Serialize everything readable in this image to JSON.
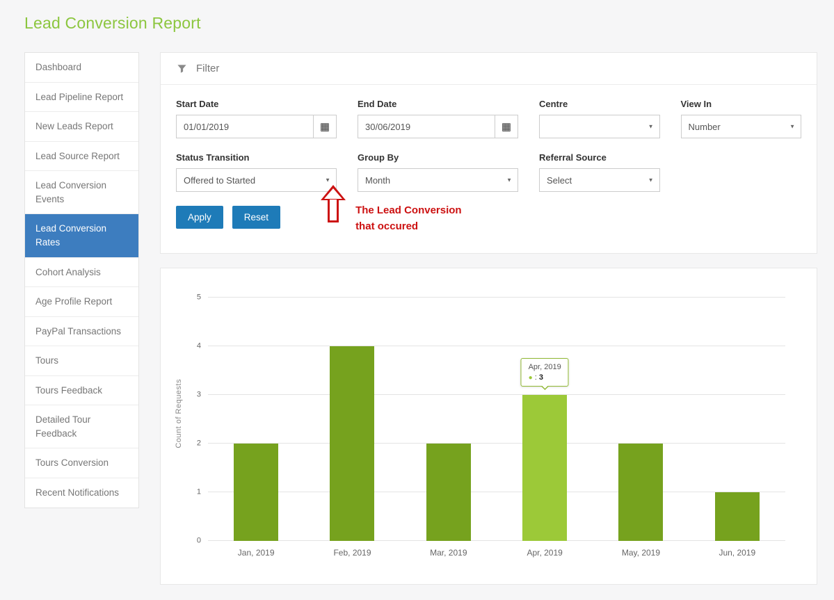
{
  "page": {
    "title": "Lead Conversion Report"
  },
  "colors": {
    "title_green": "#8cc63f",
    "sidebar_active_bg": "#3d7dbf",
    "button_blue": "#1e7bb8",
    "annotation_red": "#cc1212",
    "bar_green": "#76a21e",
    "bar_highlight_green": "#9cc938",
    "tooltip_border_green": "#8fb832"
  },
  "icons": {
    "filter": "funnel-icon",
    "calendar": "▦",
    "select_caret": "▼"
  },
  "sidebar": {
    "items": [
      {
        "label": "Dashboard",
        "active": false
      },
      {
        "label": "Lead Pipeline Report",
        "active": false
      },
      {
        "label": "New Leads Report",
        "active": false
      },
      {
        "label": "Lead Source Report",
        "active": false
      },
      {
        "label": "Lead Conversion Events",
        "active": false
      },
      {
        "label": "Lead Conversion Rates",
        "active": true
      },
      {
        "label": "Cohort Analysis",
        "active": false
      },
      {
        "label": "Age Profile Report",
        "active": false
      },
      {
        "label": "PayPal Transactions",
        "active": false
      },
      {
        "label": "Tours",
        "active": false
      },
      {
        "label": "Tours Feedback",
        "active": false
      },
      {
        "label": "Detailed Tour Feedback",
        "active": false
      },
      {
        "label": "Tours Conversion",
        "active": false
      },
      {
        "label": "Recent Notifications",
        "active": false
      }
    ]
  },
  "filter": {
    "title": "Filter",
    "fields": {
      "start_date": {
        "label": "Start Date",
        "value": "01/01/2019"
      },
      "end_date": {
        "label": "End Date",
        "value": "30/06/2019"
      },
      "centre": {
        "label": "Centre",
        "value": ""
      },
      "view_in": {
        "label": "View In",
        "value": "Number"
      },
      "status_transition": {
        "label": "Status Transition",
        "value": "Offered to Started"
      },
      "group_by": {
        "label": "Group By",
        "value": "Month"
      },
      "referral_source": {
        "label": "Referral Source",
        "value": "Select"
      }
    },
    "apply_label": "Apply",
    "reset_label": "Reset"
  },
  "annotation": {
    "line1": "The Lead Conversion",
    "line2": "that occured"
  },
  "chart": {
    "tooltip": {
      "title": "Apr, 2019",
      "dot": "●",
      "separator": ":",
      "value": "3"
    }
  },
  "chart_data": {
    "type": "bar",
    "title": "",
    "categories": [
      "Jan, 2019",
      "Feb, 2019",
      "Mar, 2019",
      "Apr, 2019",
      "May, 2019",
      "Jun, 2019"
    ],
    "values": [
      2,
      4,
      2,
      3,
      2,
      1
    ],
    "highlight_index": 3,
    "xlabel": "",
    "ylabel": "Count of Requests",
    "ylim": [
      0,
      5
    ],
    "yticks": [
      0,
      1,
      2,
      3,
      4,
      5
    ],
    "grid": true,
    "legend": "none",
    "bar_color": "#76a21e",
    "highlight_color": "#9cc938"
  }
}
